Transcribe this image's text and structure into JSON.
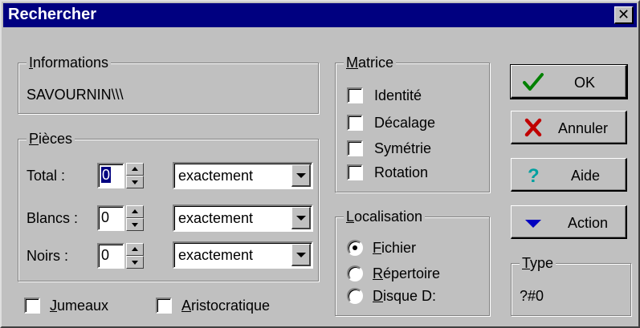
{
  "window": {
    "title": "Rechercher",
    "close_glyph": "✕"
  },
  "informations": {
    "legend_prefix": "",
    "legend_key": "I",
    "legend_rest": "nformations",
    "value": "SAVOURNIN\\\\\\"
  },
  "pieces": {
    "legend_key": "P",
    "legend_rest": "ièces",
    "rows": [
      {
        "label": "Total :",
        "value": "0",
        "selected": true,
        "mode": "exactement"
      },
      {
        "label": "Blancs :",
        "value": "0",
        "selected": false,
        "mode": "exactement"
      },
      {
        "label": "Noirs :",
        "value": "0",
        "selected": false,
        "mode": "exactement"
      }
    ]
  },
  "options": {
    "jumeaux": {
      "key": "J",
      "rest": "umeaux",
      "checked": false
    },
    "aristocratique": {
      "key": "A",
      "rest": "ristocratique",
      "checked": false
    }
  },
  "matrice": {
    "legend_key": "M",
    "legend_rest": "atrice",
    "items": [
      {
        "label": "Identité",
        "checked": false
      },
      {
        "label": "Décalage",
        "checked": false
      },
      {
        "label": "Symétrie",
        "checked": false
      },
      {
        "label": "Rotation",
        "checked": false
      }
    ]
  },
  "localisation": {
    "legend_key": "L",
    "legend_rest": "ocalisation",
    "items": [
      {
        "key": "F",
        "rest": "ichier",
        "selected": true
      },
      {
        "key": "R",
        "rest": "épertoire",
        "selected": false
      },
      {
        "key": "D",
        "rest": "isque D:",
        "selected": false
      }
    ]
  },
  "buttons": {
    "ok": {
      "label": "OK",
      "icon": "checkmark-icon",
      "color": "#008000"
    },
    "annuler": {
      "label": "Annuler",
      "icon": "cross-icon",
      "color": "#c00000"
    },
    "aide": {
      "label": "Aide",
      "icon": "question-icon",
      "color": "#00a0a0"
    },
    "action": {
      "label": "Action",
      "icon": "triangle-down-icon",
      "color": "#0000c0"
    }
  },
  "type": {
    "legend_key": "T",
    "legend_rest": "ype",
    "value": "?#0"
  }
}
